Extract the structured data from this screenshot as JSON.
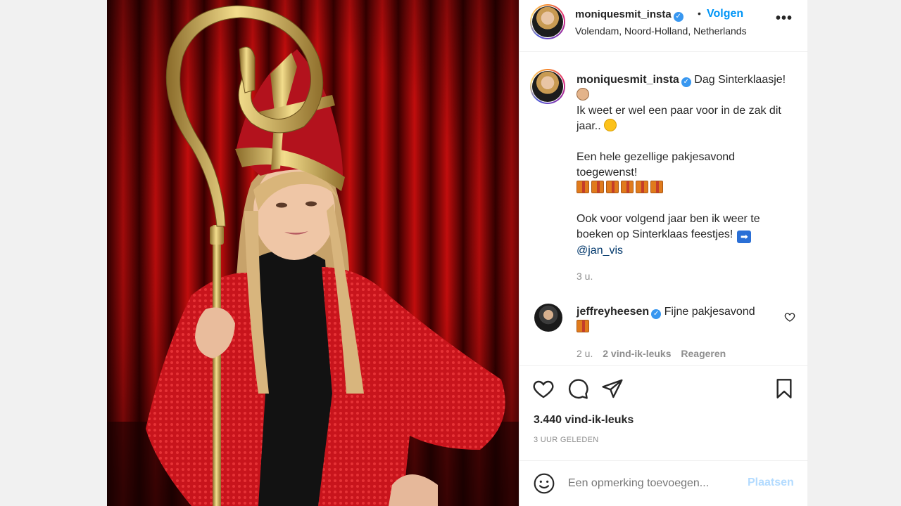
{
  "post": {
    "username": "moniquesmit_insta",
    "follow_label": "Volgen",
    "separator": "•",
    "location": "Volendam, Noord-Holland, Netherlands",
    "more_label": "•••",
    "caption": {
      "username": "moniquesmit_insta",
      "line1": "Dag Sinterklaasje!",
      "line2": "Ik weet er wel een paar voor in de zak dit",
      "line3": "jaar..",
      "line4": "Een hele gezellige pakjesavond",
      "line5": "toegewenst!",
      "line6": "Ook voor volgend jaar ben ik weer te",
      "line7": "boeken op Sinterklaas feestjes!",
      "mention": "@jan_vis",
      "time": "3 u."
    },
    "comment": {
      "username": "jeffreyheesen",
      "text": "Fijne pakjesavond",
      "time": "2 u.",
      "likes": "2 vind-ik-leuks",
      "reply": "Reageren"
    },
    "likes": "3.440 vind-ik-leuks",
    "posted": "3 UUR GELEDEN",
    "composer": {
      "placeholder": "Een opmerking toevoegen...",
      "post_label": "Plaatsen"
    }
  },
  "colors": {
    "link_blue": "#0095f6",
    "verified_blue": "#3897f0",
    "muted": "#8e8e8e",
    "post_disabled": "#b3dbff"
  },
  "icons": [
    "heart-icon",
    "comment-icon",
    "share-icon",
    "bookmark-icon",
    "emoji-icon",
    "verified-badge-icon",
    "more-options-icon"
  ]
}
